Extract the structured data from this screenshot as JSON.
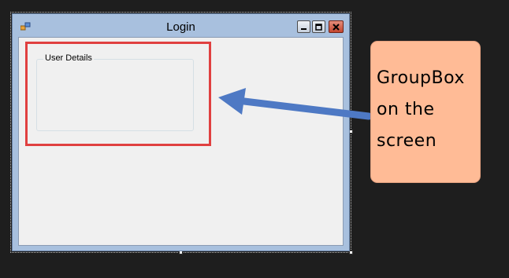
{
  "window": {
    "title": "Login",
    "controls": [
      "minimize",
      "maximize",
      "close"
    ]
  },
  "groupbox": {
    "legend": "User Details"
  },
  "annotation": {
    "lines": [
      "GroupBox",
      "on the",
      "screen"
    ],
    "callout_color": "#ffbb96",
    "highlight_color": "#e04040",
    "arrow_color": "#4e79c4"
  },
  "icons": {
    "app": "form-icon",
    "minimize": "minimize-icon",
    "maximize": "maximize-icon",
    "close": "close-icon"
  }
}
